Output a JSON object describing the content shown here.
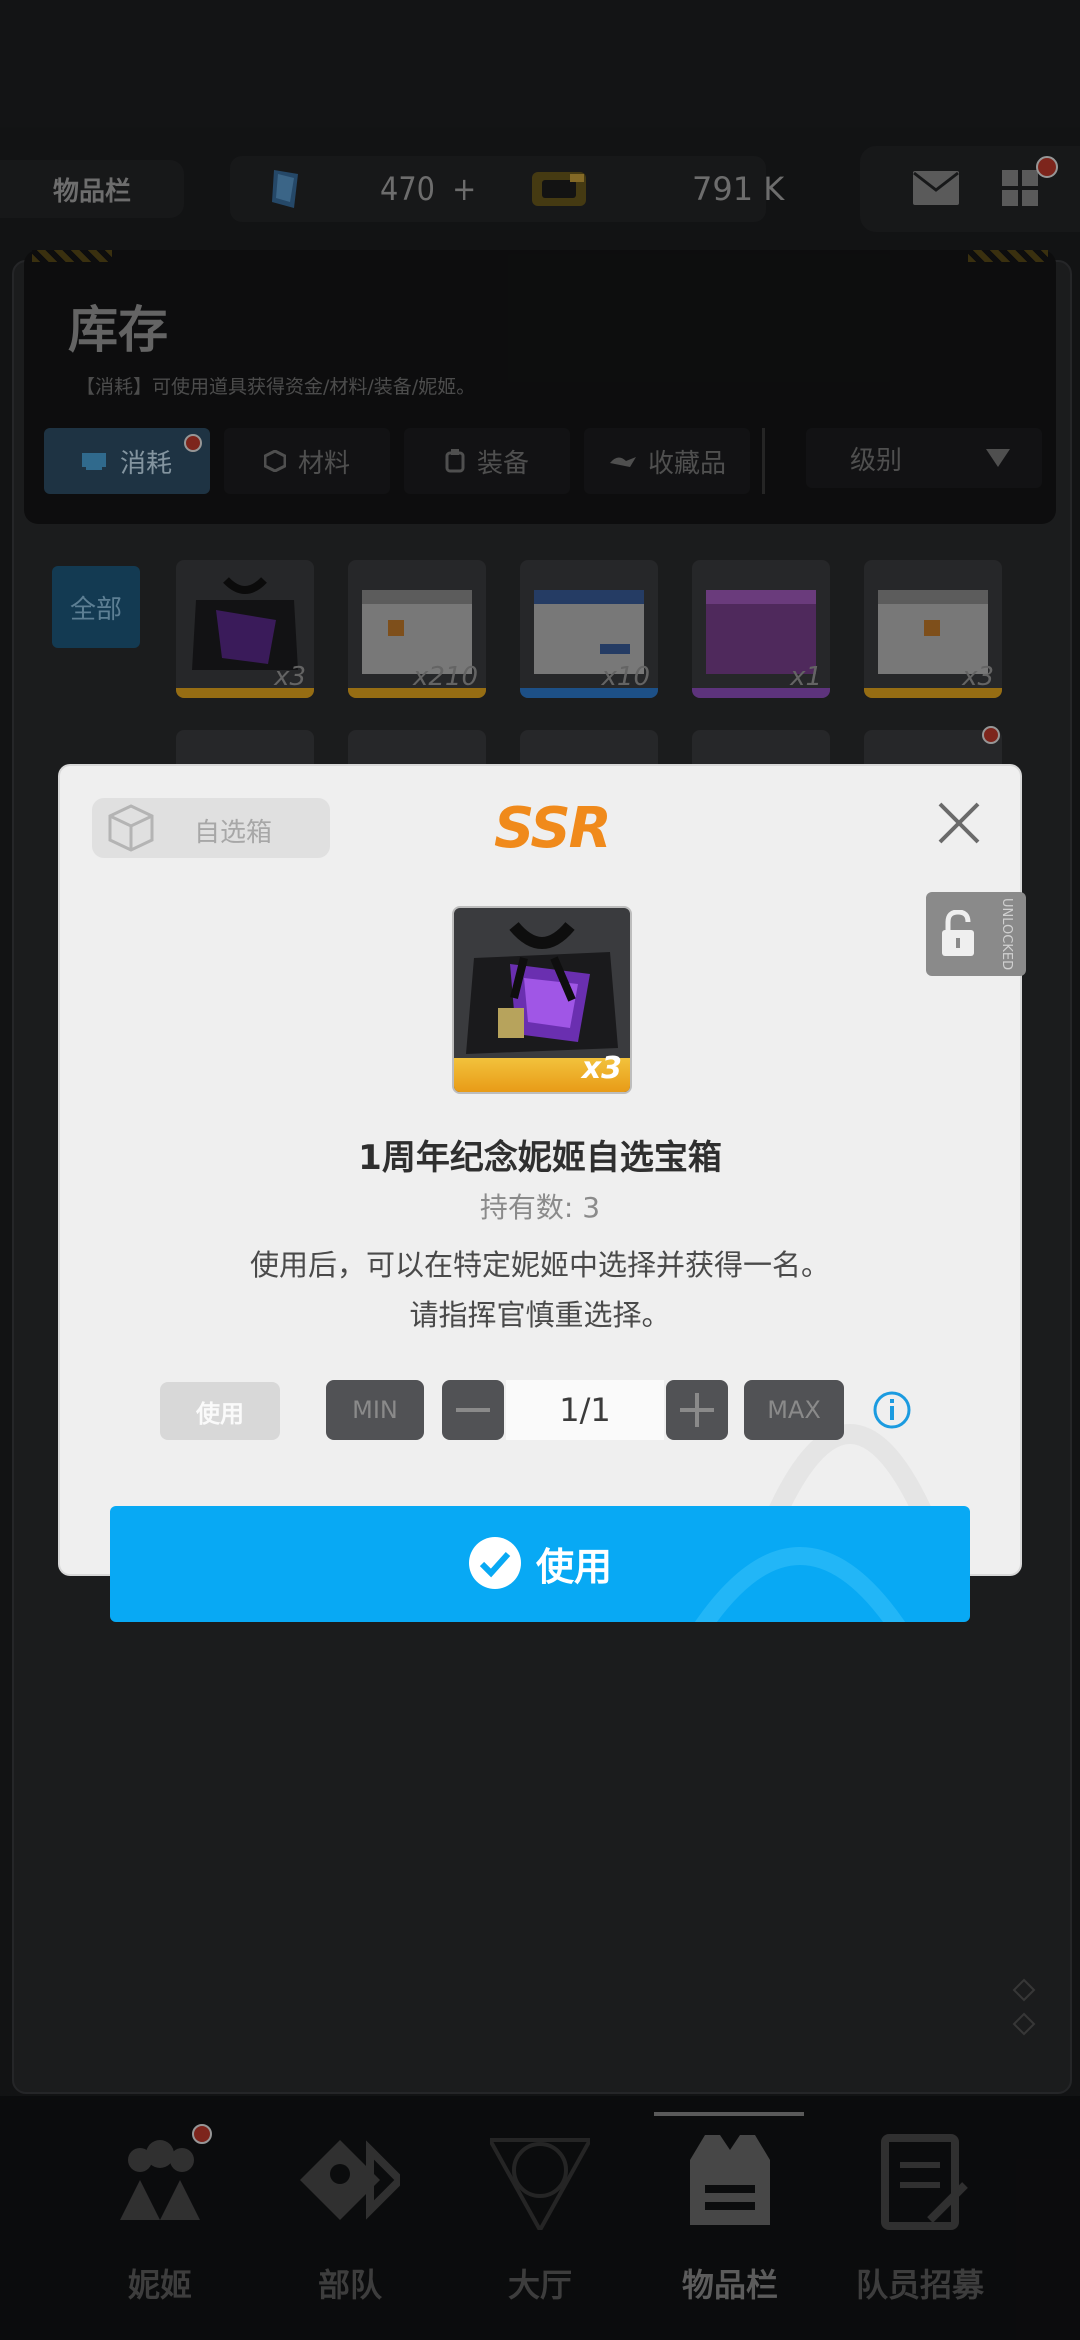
{
  "topbar": {
    "title": "物品栏",
    "currency_gem": "470",
    "currency_plus": "+",
    "currency_credits": "791 K"
  },
  "inventory": {
    "title": "库存",
    "subtitle": "【消耗】可使用道具获得资金/材料/装备/妮姬。",
    "tabs": [
      "消耗",
      "材料",
      "装备",
      "收藏品"
    ],
    "sort_label": "级别",
    "all_button": "全部",
    "items": [
      {
        "qty": "x3",
        "bar": "#e6a81e"
      },
      {
        "qty": "x210",
        "bar": "#e6a81e"
      },
      {
        "qty": "x10",
        "bar": "#2d7ccf"
      },
      {
        "qty": "x1",
        "bar": "#8f4fbf"
      },
      {
        "qty": "x3",
        "bar": "#e6a81e"
      }
    ]
  },
  "modal": {
    "chip_label": "自选箱",
    "rarity": "SSR",
    "lock_text": "UNLOCKED",
    "item_qty": "x3",
    "item_name": "1周年纪念妮姬自选宝箱",
    "held": "持有数: 3",
    "desc_line1": "使用后，可以在特定妮姬中选择并获得一名。",
    "desc_line2": "请指挥官慎重选择。",
    "use_small": "使用",
    "min_label": "MIN",
    "max_label": "MAX",
    "quantity": "1/1",
    "use_button": "使用"
  },
  "nav": {
    "items": [
      "妮姬",
      "部队",
      "大厅",
      "物品栏",
      "队员招募"
    ]
  },
  "colors": {
    "accent": "#08a9f4",
    "ssr": "#f08a1b"
  }
}
